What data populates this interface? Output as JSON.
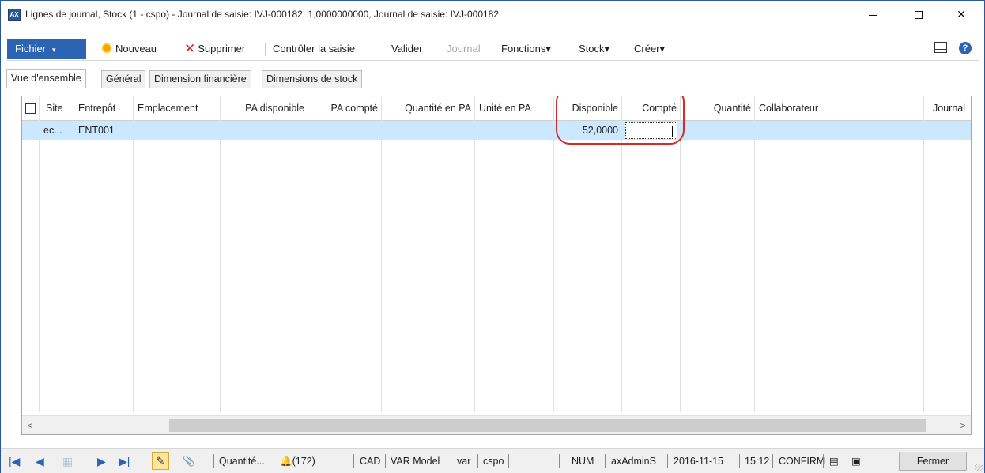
{
  "window": {
    "icon_text": "AX",
    "title": "Lignes de journal, Stock (1 - cspo) - Journal de saisie: IVJ-000182, 1,0000000000, Journal de saisie: IVJ-000182",
    "minimize_glyph": "—",
    "maximize_glyph": "☐",
    "close_glyph": "✕"
  },
  "actionpane": {
    "fichier": "Fichier",
    "caret": "▾",
    "nouveau": "Nouveau",
    "supprimer": "Supprimer",
    "controler": "Contrôler la saisie",
    "valider": "Valider",
    "journal": "Journal",
    "fonctions": "Fonctions▾",
    "stock": "Stock▾",
    "creer": "Créer▾",
    "help": "?"
  },
  "tabs": [
    {
      "label": "Vue d'ensemble"
    },
    {
      "label": "Général"
    },
    {
      "label": "Dimension financière"
    },
    {
      "label": "Dimensions de stock"
    }
  ],
  "grid": {
    "columns": [
      "Site",
      "Entrepôt",
      "Emplacement",
      "PA disponible",
      "PA compté",
      "Quantité en PA",
      "Unité en PA",
      "Disponible",
      "Compté",
      "Quantité",
      "Collaborateur",
      "Journal"
    ],
    "rows": [
      {
        "site": "ec...",
        "entrepot": "ENT001",
        "disponible": "52,0000",
        "compte": ""
      }
    ]
  },
  "scroll": {
    "left": "<",
    "right": ">"
  },
  "status": {
    "first": "|◀",
    "prev": "◀",
    "grid_icon": "▦",
    "next": "▶",
    "last": "▶|",
    "pencil": "✎",
    "doc_icon": "📎",
    "field": "Quantité...",
    "alerts": "(172)",
    "currency": "CAD",
    "model": "VAR Model",
    "layer": "var",
    "company": "cspo",
    "num": "NUM",
    "user": "axAdminS",
    "date": "2016-11-15",
    "time": "15:12",
    "db": "CONFIRM",
    "close_button": "Fermer"
  },
  "colors": {
    "accent": "#2c64b4",
    "selection": "#cce8ff",
    "highlight_ring": "#d42b2b"
  }
}
